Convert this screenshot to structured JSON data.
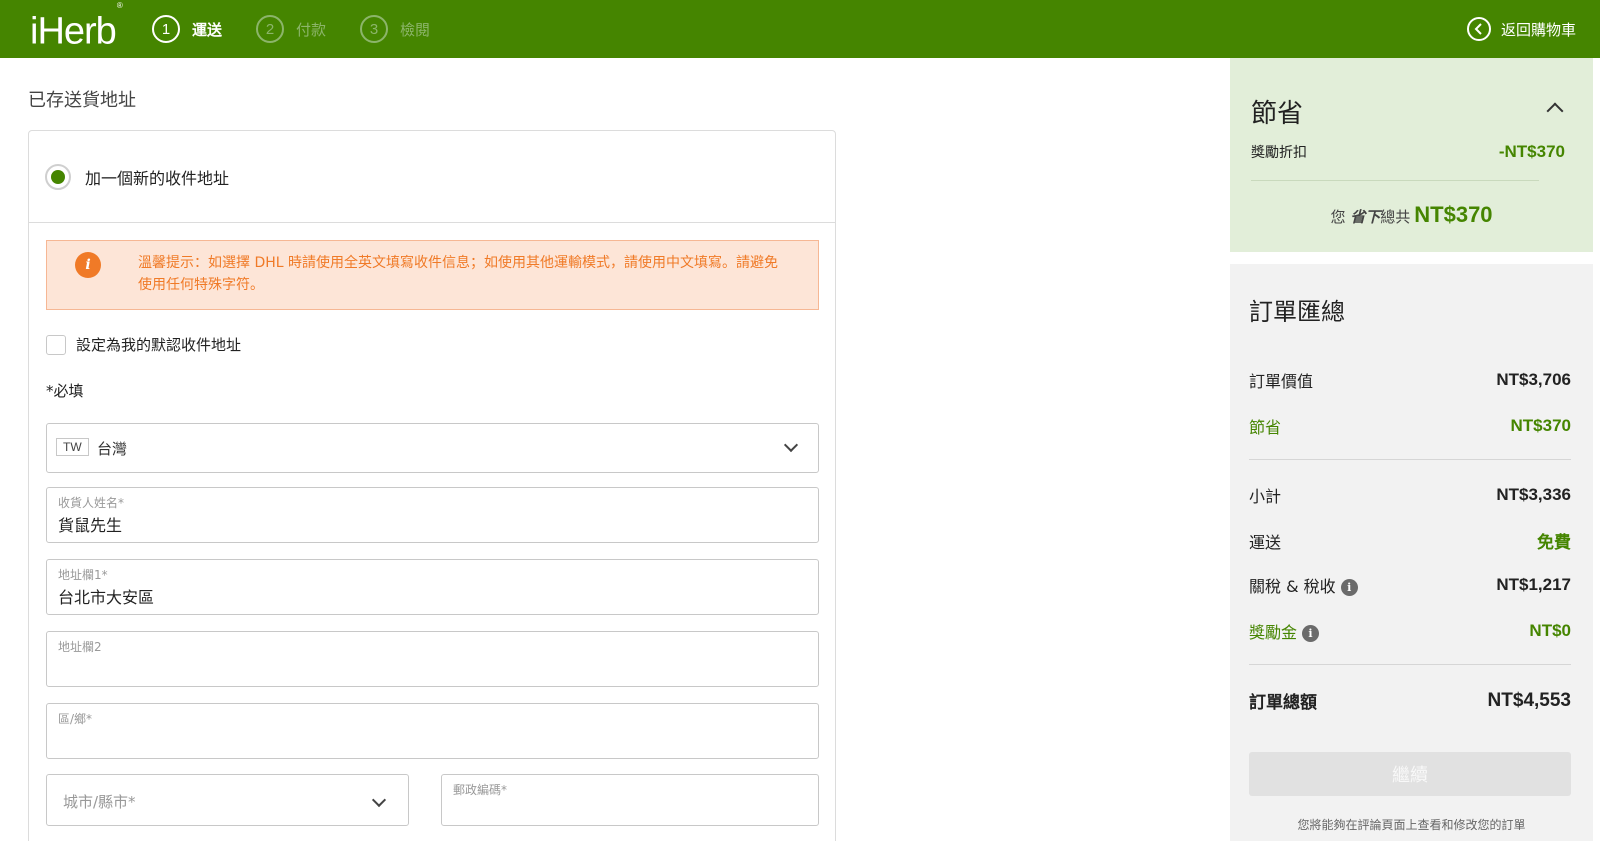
{
  "header": {
    "logo": "iHerb",
    "logo_mark": "®",
    "steps": [
      {
        "num": "1",
        "label": "運送"
      },
      {
        "num": "2",
        "label": "付款"
      },
      {
        "num": "3",
        "label": "檢閱"
      }
    ],
    "back_label": "返回購物車"
  },
  "main": {
    "section_title": "已存送貨地址",
    "new_address_label": "加一個新的收件地址",
    "warning": "溫馨提示：如選擇 DHL 時請使用全英文填寫收件信息；如使用其他運輸模式，請使用中文填寫。請避免使用任何特殊字符。",
    "default_checkbox_label": "設定為我的默認收件地址",
    "required_note": "*必填",
    "country": {
      "code": "TW",
      "name": "台灣"
    },
    "fields": {
      "name": {
        "label": "收貨人姓名*",
        "value": "貨鼠先生"
      },
      "address1": {
        "label": "地址欄1*",
        "value": "台北市大安區"
      },
      "address2": {
        "label": "地址欄2",
        "value": ""
      },
      "district": {
        "label": "區/鄉*",
        "value": ""
      },
      "city": {
        "placeholder": "城市/縣市*"
      },
      "postal": {
        "label": "郵政編碼*",
        "value": ""
      }
    }
  },
  "savings": {
    "title": "節省",
    "reward_label": "獎勵折扣",
    "reward_value": "-NT$370",
    "total_prefix": "您",
    "total_emph": "省下",
    "total_suffix": "總共",
    "total_amount": "NT$370"
  },
  "summary": {
    "title": "訂單匯總",
    "order_value": {
      "label": "訂單價值",
      "value": "NT$3,706"
    },
    "savings": {
      "label": "節省",
      "value": "NT$370"
    },
    "subtotal": {
      "label": "小計",
      "value": "NT$3,336"
    },
    "shipping": {
      "label": "運送",
      "value": "免費"
    },
    "duties": {
      "label": "關稅 & 稅收",
      "value": "NT$1,217"
    },
    "rewards": {
      "label": "獎勵金",
      "value": "NT$0"
    },
    "total": {
      "label": "訂單總額",
      "value": "NT$4,553"
    },
    "continue_label": "繼續",
    "note": "您將能夠在評論頁面上查看和修改您的訂單"
  },
  "colors": {
    "brand": "#458500",
    "warning": "#f07a27"
  }
}
